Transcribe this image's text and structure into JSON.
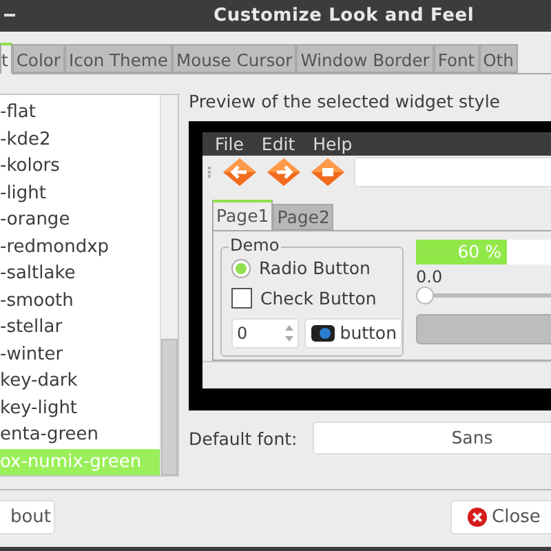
{
  "window": {
    "title": "Customize Look and Feel"
  },
  "tabs": [
    {
      "label": "t",
      "selected": true
    },
    {
      "label": "Color",
      "selected": false
    },
    {
      "label": "Icon Theme",
      "selected": false
    },
    {
      "label": "Mouse Cursor",
      "selected": false
    },
    {
      "label": "Window Border",
      "selected": false
    },
    {
      "label": "Font",
      "selected": false
    },
    {
      "label": "Oth",
      "selected": false
    }
  ],
  "themes": [
    {
      "name": "-flat",
      "selected": false
    },
    {
      "name": "-kde2",
      "selected": false
    },
    {
      "name": "-kolors",
      "selected": false
    },
    {
      "name": "-light",
      "selected": false
    },
    {
      "name": "-orange",
      "selected": false
    },
    {
      "name": "-redmondxp",
      "selected": false
    },
    {
      "name": "-saltlake",
      "selected": false
    },
    {
      "name": "-smooth",
      "selected": false
    },
    {
      "name": "-stellar",
      "selected": false
    },
    {
      "name": "-winter",
      "selected": false
    },
    {
      "name": "key-dark",
      "selected": false
    },
    {
      "name": "key-light",
      "selected": false
    },
    {
      "name": "enta-green",
      "selected": false
    },
    {
      "name": "ox-numix-green",
      "selected": true
    }
  ],
  "preview": {
    "label": "Preview of the selected widget style",
    "menu": [
      "File",
      "Edit",
      "Help"
    ],
    "tabs": [
      {
        "label": "Page1",
        "selected": true
      },
      {
        "label": "Page2",
        "selected": false
      }
    ],
    "demo_title": "Demo",
    "radio": {
      "label": "Radio Button",
      "checked": true
    },
    "check": {
      "label": "Check Button",
      "checked": false
    },
    "spin_value": "0",
    "button": "button",
    "progress": {
      "level": 0.6,
      "text": "60 %"
    },
    "slider": {
      "reading": "0.0",
      "level": 0
    }
  },
  "default_font": {
    "label": "Default font:",
    "value": "Sans"
  },
  "buttons": {
    "about": "bout",
    "close": "Close"
  }
}
